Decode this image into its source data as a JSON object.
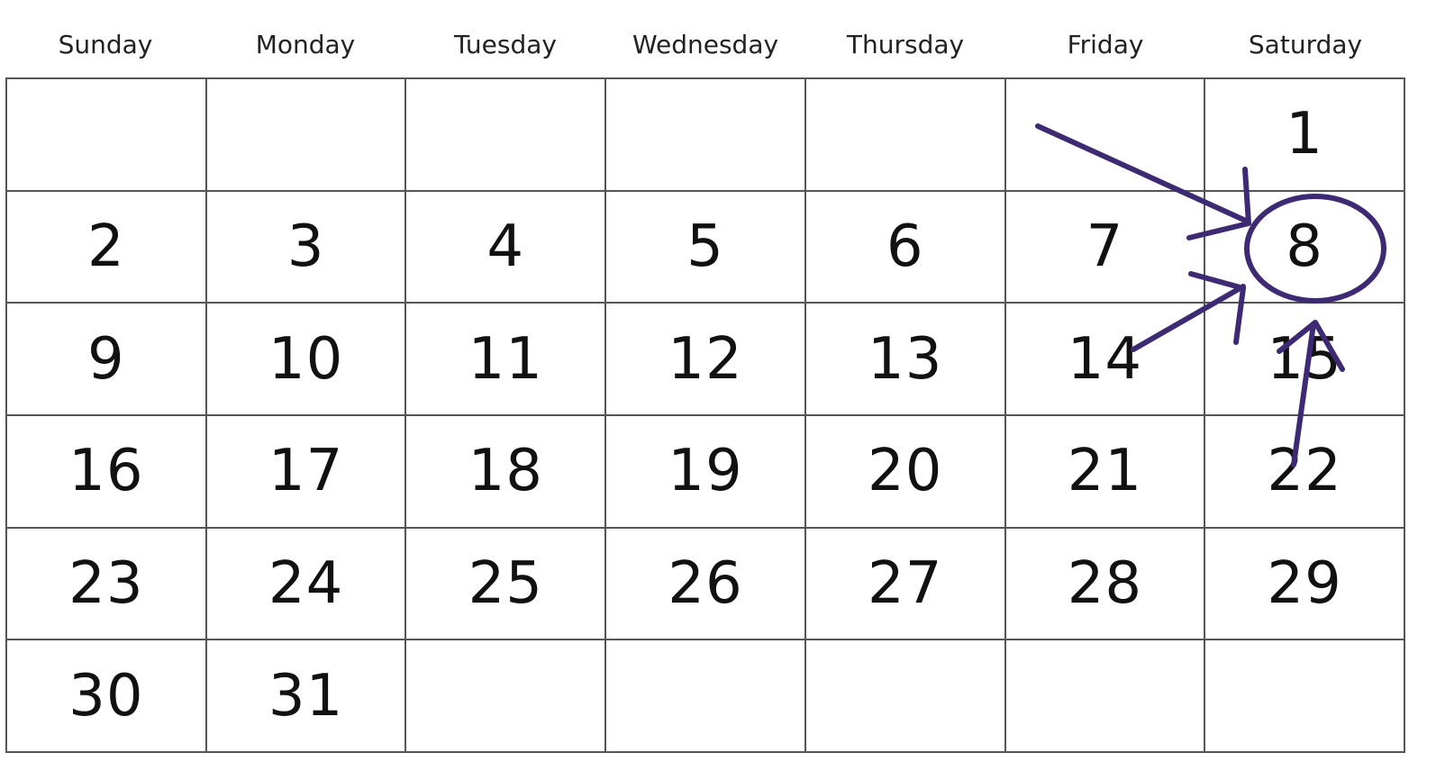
{
  "calendar": {
    "weekdays": [
      "Sunday",
      "Monday",
      "Tuesday",
      "Wednesday",
      "Thursday",
      "Friday",
      "Saturday"
    ],
    "weeks": [
      [
        "",
        "",
        "",
        "",
        "",
        "",
        "1"
      ],
      [
        "2",
        "3",
        "4",
        "5",
        "6",
        "7",
        "8"
      ],
      [
        "9",
        "10",
        "11",
        "12",
        "13",
        "14",
        "15"
      ],
      [
        "16",
        "17",
        "18",
        "19",
        "20",
        "21",
        "22"
      ],
      [
        "23",
        "24",
        "25",
        "26",
        "27",
        "28",
        "29"
      ],
      [
        "30",
        "31",
        "",
        "",
        "",
        "",
        ""
      ]
    ],
    "highlighted_day": "8"
  },
  "annotation": {
    "color": "#3d2a73",
    "type": "hand-drawn circle with arrows"
  }
}
